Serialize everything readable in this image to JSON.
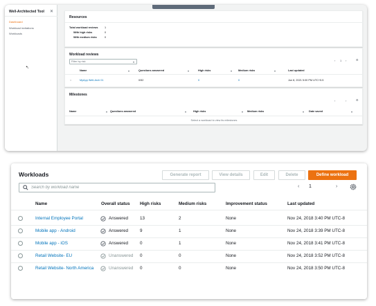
{
  "top": {
    "sidebar": {
      "title": "Well-Architected Tool",
      "close": "✕",
      "items": [
        "Dashboard",
        "Workload invitations",
        "Workloads"
      ]
    },
    "resources": {
      "title": "Resources",
      "rows": [
        {
          "label": "Total workload reviews",
          "value": "1"
        },
        {
          "label": "With high risks",
          "value": "0"
        },
        {
          "label": "With medium risks",
          "value": "0"
        }
      ]
    },
    "reviews": {
      "title": "Workload reviews",
      "filter_placeholder": "Filter by risk",
      "page": "1",
      "columns": [
        "Name",
        "Questions answered",
        "High risks",
        "Medium risks",
        "Last updated"
      ],
      "row": {
        "name": "MyApp Well-Arch 01",
        "questions": "0/52",
        "high": "0",
        "medium": "0",
        "updated": "Jun 8, 2021 5:00 PM UTC+5.5"
      }
    },
    "milestones": {
      "title": "Milestones",
      "columns": [
        "Name",
        "Questions answered",
        "High risks",
        "Medium risks",
        "Date saved"
      ],
      "empty": "Select a workload to view its milestones"
    }
  },
  "workloads": {
    "title": "Workloads",
    "buttons": {
      "generate": "Generate report",
      "view": "View details",
      "edit": "Edit",
      "delete": "Delete",
      "define": "Define workload"
    },
    "search_placeholder": "Search by workload name",
    "page": "1",
    "columns": [
      "Name",
      "Overall status",
      "High risks",
      "Medium risks",
      "Improvement status",
      "Last updated"
    ],
    "rows": [
      {
        "name": "Internal Employee Portal",
        "status": "Answered",
        "high": "13",
        "medium": "2",
        "improvement": "None",
        "updated": "Nov 24, 2018 3:40 PM UTC-8"
      },
      {
        "name": "Mobile app - Android",
        "status": "Answered",
        "high": "9",
        "medium": "1",
        "improvement": "None",
        "updated": "Nov 24, 2018 3:39 PM UTC-8"
      },
      {
        "name": "Mobile app - iOS",
        "status": "Answered",
        "high": "0",
        "medium": "1",
        "improvement": "None",
        "updated": "Nov 24, 2018 3:41 PM UTC-8"
      },
      {
        "name": "Retail Website- EU",
        "status": "Unanswered",
        "high": "0",
        "medium": "0",
        "improvement": "None",
        "updated": "Nov 24, 2018 3:52 PM UTC-8"
      },
      {
        "name": "Retail Website- North America",
        "status": "Unanswered",
        "high": "0",
        "medium": "0",
        "improvement": "None",
        "updated": "Nov 24, 2018 3:50 PM UTC-8"
      }
    ]
  },
  "colors": {
    "accent": "#ec7211",
    "link": "#0073bb",
    "text": "#16191f",
    "muted": "#879596"
  }
}
